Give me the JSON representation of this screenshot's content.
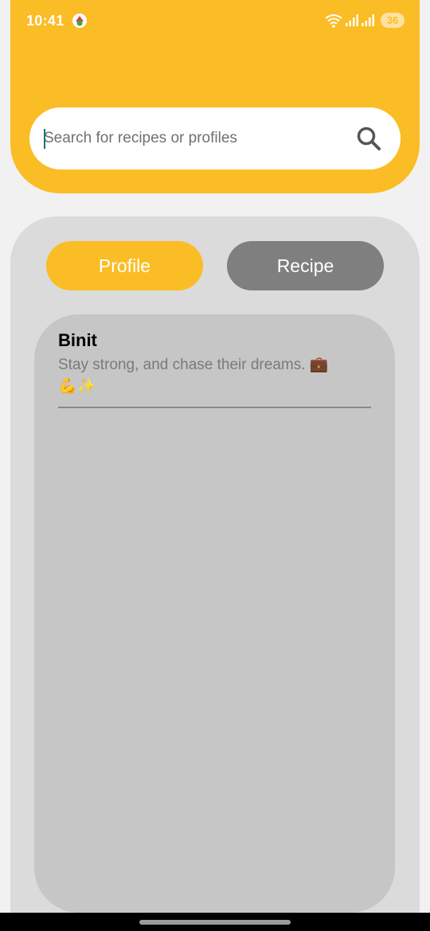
{
  "status_bar": {
    "time": "10:41",
    "battery": "36"
  },
  "search": {
    "placeholder": "Search for recipes or profiles",
    "icon": "search-icon"
  },
  "tabs": [
    {
      "label": "Profile",
      "active": true,
      "color": "#fbbd25"
    },
    {
      "label": "Recipe",
      "active": false,
      "color": "#7f7f7f"
    }
  ],
  "results": [
    {
      "name": "Binit",
      "bio": "Stay strong, and chase their dreams.",
      "bio_emoji_1": "💼",
      "bio_emoji_2": "💪✨"
    }
  ],
  "colors": {
    "accent": "#fbbd25",
    "background": "#f2f1f2",
    "panel": "#dbdbdb",
    "results_card": "#c6c6c6"
  }
}
